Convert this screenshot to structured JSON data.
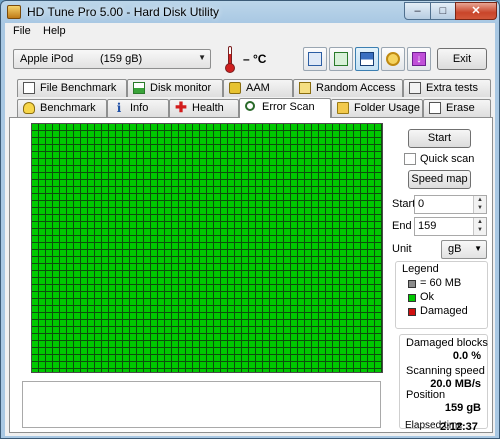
{
  "window": {
    "title": "HD Tune Pro 5.00 - Hard Disk Utility",
    "caption_minimize": "–",
    "caption_maximize": "□",
    "caption_close": "✕"
  },
  "menu": {
    "file": "File",
    "help": "Help"
  },
  "toolbar": {
    "drive": {
      "name": "Apple   iPod",
      "size": "(159 gB)"
    },
    "temperature": "– °C",
    "exit_label": "Exit",
    "icons": [
      "copy-text-icon",
      "copy-screen-icon",
      "save-icon",
      "options-icon",
      "exit-arrow-icon"
    ]
  },
  "tabs": {
    "row1": [
      {
        "label": "File Benchmark",
        "icon": "file-benchmark-icon"
      },
      {
        "label": "Disk monitor",
        "icon": "disk-monitor-icon"
      },
      {
        "label": "AAM",
        "icon": "speaker-icon"
      },
      {
        "label": "Random Access",
        "icon": "random-access-icon"
      },
      {
        "label": "Extra tests",
        "icon": "extra-tests-icon"
      }
    ],
    "row2": [
      {
        "label": "Benchmark",
        "icon": "bulb-icon"
      },
      {
        "label": "Info",
        "icon": "info-icon"
      },
      {
        "label": "Health",
        "icon": "health-cross-icon"
      },
      {
        "label": "Error Scan",
        "icon": "magnifier-icon",
        "active": true
      },
      {
        "label": "Folder Usage",
        "icon": "folder-icon"
      },
      {
        "label": "Erase",
        "icon": "erase-icon"
      }
    ]
  },
  "scan": {
    "block_color_ok": "#00c800",
    "grid_line_color": "#0d4d0d",
    "status": "all blocks ok",
    "start_button": "Start",
    "quick_scan_label": "Quick scan",
    "quick_scan_checked": false,
    "speed_map_button": "Speed map",
    "start_label": "Start",
    "start_value": "0",
    "end_label": "End",
    "end_value": "159",
    "unit_label": "Unit",
    "unit_value": "gB"
  },
  "legend": {
    "title": "Legend",
    "items": [
      {
        "label": "= 60 MB",
        "color": "#8c8c8c"
      },
      {
        "label": "Ok",
        "color": "#00c800"
      },
      {
        "label": "Damaged",
        "color": "#d01010"
      }
    ]
  },
  "stats": {
    "damaged_label": "Damaged blocks",
    "damaged_value": "0.0 %",
    "speed_label": "Scanning speed",
    "speed_value": "20.0 MB/s",
    "position_label": "Position",
    "position_value": "159 gB",
    "elapsed_label": "Elapsed time",
    "elapsed_value": "2:12:37"
  }
}
